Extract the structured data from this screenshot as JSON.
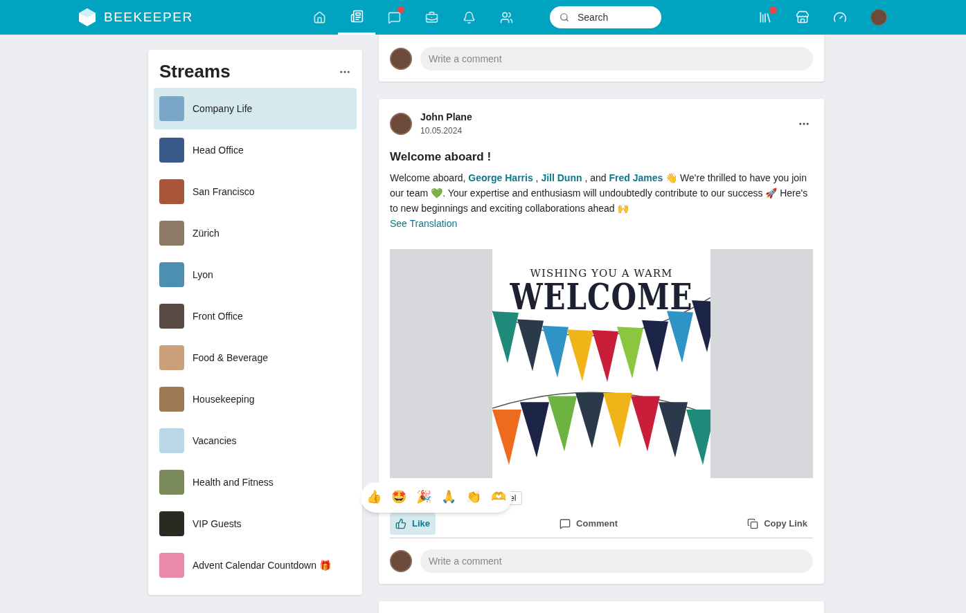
{
  "brand": "BEEKEEPER",
  "nav": [
    {
      "kind": "home",
      "selected": false,
      "badge": false
    },
    {
      "kind": "feed",
      "selected": true,
      "badge": false
    },
    {
      "kind": "chat",
      "selected": false,
      "badge": true
    },
    {
      "kind": "toolbox",
      "selected": false,
      "badge": false
    },
    {
      "kind": "bell",
      "selected": false,
      "badge": false
    },
    {
      "kind": "people",
      "selected": false,
      "badge": false
    }
  ],
  "search": {
    "placeholder": "Search"
  },
  "right_nav": [
    {
      "kind": "library",
      "badge": true
    },
    {
      "kind": "store",
      "badge": false
    },
    {
      "kind": "gauge",
      "badge": false
    }
  ],
  "streams": {
    "title": "Streams",
    "items": [
      {
        "name": "Company Life",
        "selected": true,
        "color": "#7aa7c7"
      },
      {
        "name": "Head Office",
        "selected": false,
        "color": "#3b5a8c"
      },
      {
        "name": "San Francisco",
        "selected": false,
        "color": "#a8553a"
      },
      {
        "name": "Zürich",
        "selected": false,
        "color": "#8c7a66"
      },
      {
        "name": "Lyon",
        "selected": false,
        "color": "#4c8fb0"
      },
      {
        "name": "Front Office",
        "selected": false,
        "color": "#5a4a44"
      },
      {
        "name": "Food & Beverage",
        "selected": false,
        "color": "#c9a07a"
      },
      {
        "name": "Housekeeping",
        "selected": false,
        "color": "#9c7a55"
      },
      {
        "name": "Vacancies",
        "selected": false,
        "color": "#b9d7e6"
      },
      {
        "name": "Health and Fitness",
        "selected": false,
        "color": "#7a8a5a"
      },
      {
        "name": "VIP Guests",
        "selected": false,
        "color": "#2a2a22"
      },
      {
        "name": "Advent Calendar Countdown 🎁",
        "selected": false,
        "color": "#e88aa8"
      }
    ]
  },
  "top_comment": {
    "placeholder": "Write a comment"
  },
  "post": {
    "author": "John Plane",
    "date": "10.05.2024",
    "title": "Welcome aboard !",
    "body": [
      {
        "kind": "text",
        "text": "Welcome aboard, "
      },
      {
        "kind": "mention",
        "text": "George Harris"
      },
      {
        "kind": "text",
        "text": " , "
      },
      {
        "kind": "mention",
        "text": "Jill Dunn"
      },
      {
        "kind": "text",
        "text": " , and "
      },
      {
        "kind": "mention",
        "text": "Fred James"
      },
      {
        "kind": "text",
        "text": " 👋 We're thrilled to have you join our team 💚. Your expertise and enthusiasm will undoubtedly contribute to our success 🚀 Here's to new beginnings and exciting collaborations ahead 🙌"
      }
    ],
    "translation_link": "See Translation",
    "image": {
      "line_1": "WISHING YOU A WARM",
      "line_2": "WELCOME"
    },
    "reactions": [
      "👍",
      "🤩",
      "🎉",
      "🙏",
      "👏",
      "🫶"
    ],
    "covered_chip": "el",
    "actions": [
      {
        "kind": "like",
        "label": "Like",
        "selected": true
      },
      {
        "kind": "comment",
        "label": "Comment",
        "selected": false
      },
      {
        "kind": "copy",
        "label": "Copy Link",
        "selected": false
      }
    ],
    "comment": {
      "placeholder": "Write a comment"
    }
  }
}
